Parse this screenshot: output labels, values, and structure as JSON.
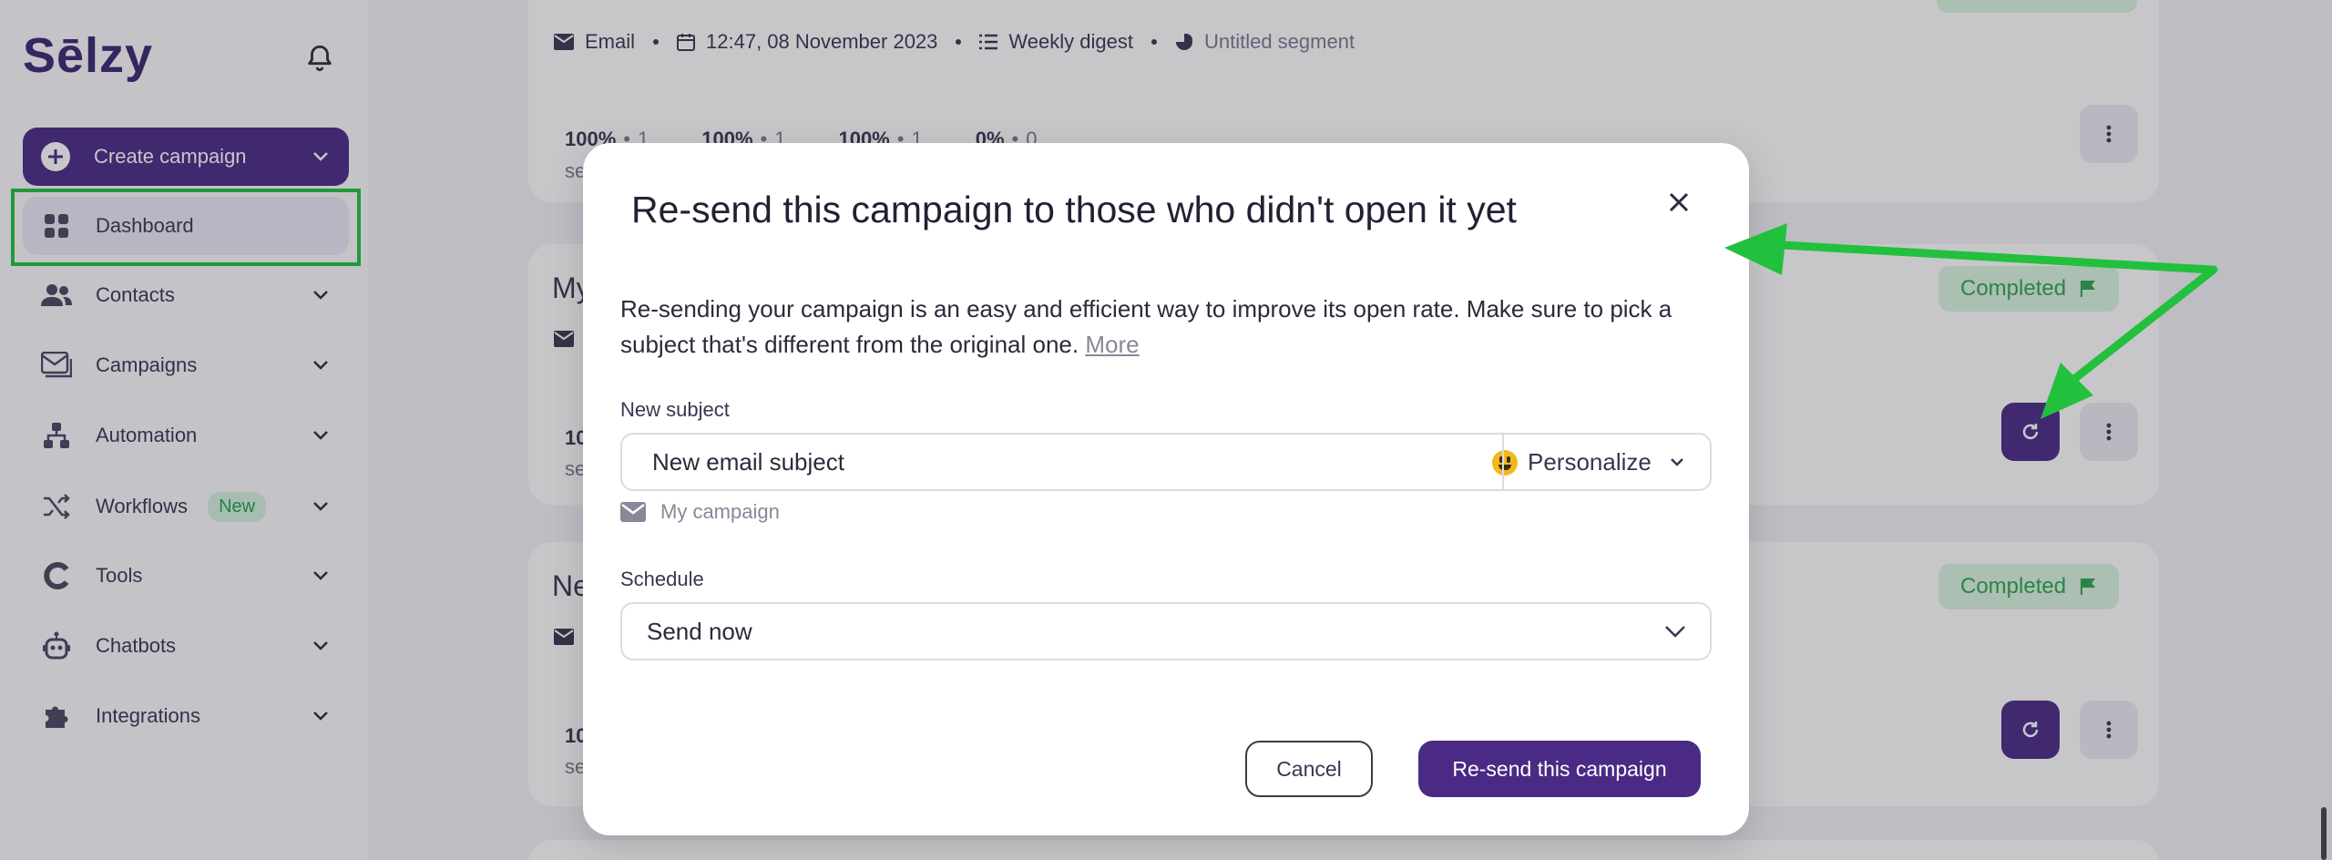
{
  "sidebar": {
    "logo": "Sēlzy",
    "create_label": "Create campaign",
    "items": [
      {
        "label": "Dashboard"
      },
      {
        "label": "Contacts"
      },
      {
        "label": "Campaigns"
      },
      {
        "label": "Automation"
      },
      {
        "label": "Workflows",
        "badge": "New"
      },
      {
        "label": "Tools"
      },
      {
        "label": "Chatbots"
      },
      {
        "label": "Integrations"
      }
    ]
  },
  "background": {
    "meta_type": "Email",
    "meta_date": "12:47, 08 November 2023",
    "meta_list": "Weekly digest",
    "meta_segment": "Untitled segment",
    "stats": [
      "100%",
      "1",
      "100%",
      "1",
      "100%",
      "1",
      "0%",
      "0"
    ],
    "card2_title_start": "My",
    "card3_title_start": "Ne",
    "stat_start": "10",
    "sub_start": "se",
    "status_label": "Completed"
  },
  "modal": {
    "title": "Re-send this campaign to those who didn't open it yet",
    "description": "Re-sending your campaign is an easy and efficient way to improve its open rate. Make sure to pick a subject that's different from the original one.",
    "more_link": "More",
    "subject_label": "New subject",
    "subject_value": "New email subject",
    "personalize_label": "Personalize",
    "campaign_name": "My campaign",
    "schedule_label": "Schedule",
    "schedule_value": "Send now",
    "cancel_label": "Cancel",
    "resend_label": "Re-send this campaign"
  },
  "colors": {
    "brand": "#4a2a85",
    "highlight": "#22c03d",
    "status_bg": "#d9f5df",
    "status_text": "#2ea451"
  }
}
